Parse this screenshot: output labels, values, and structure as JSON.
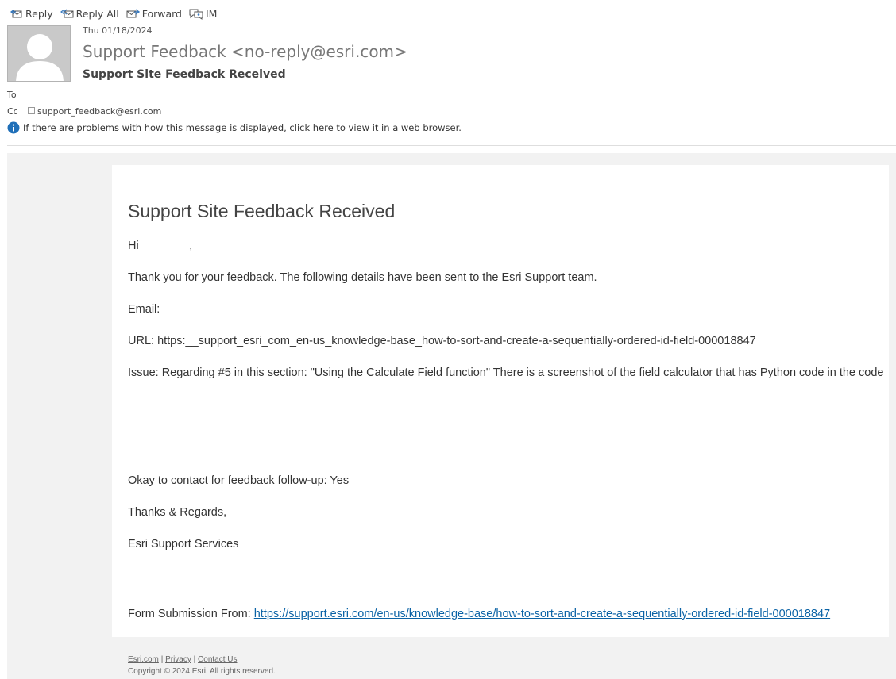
{
  "toolbar": {
    "reply": "Reply",
    "reply_all": "Reply All",
    "forward": "Forward",
    "im": "IM",
    "icons": [
      "reply-icon",
      "reply-all-icon",
      "forward-icon",
      "im-icon"
    ]
  },
  "header": {
    "date": "Thu 01/18/2024",
    "from": "Support Feedback <no-reply@esri.com>",
    "subject": "Support Site Feedback Received",
    "to_label": "To",
    "cc_label": "Cc",
    "cc_value": "support_feedback@esri.com",
    "info": "If there are problems with how this message is displayed, click here to view it in a web browser."
  },
  "message": {
    "title": "Support Site Feedback Received",
    "greeting": "Hi",
    "greeting_comma": ",",
    "intro": "Thank you for your feedback. The following details have been sent to the Esri Support team.",
    "email_line": "Email:",
    "url_line": "URL: https:__support_esri_com_en-us_knowledge-base_how-to-sort-and-create-a-sequentially-ordered-id-field-000018847",
    "issue_line": "Issue: Regarding #5 in this section: \"Using the Calculate Field function\" There is a screenshot of the field calculator that has Python code in the code",
    "followup": "Okay to contact for feedback follow-up: Yes",
    "thanks": "Thanks & Regards,",
    "signature": "Esri Support Services",
    "form_label": "Form Submission From: ",
    "form_link": "https://support.esri.com/en-us/knowledge-base/how-to-sort-and-create-a-sequentially-ordered-id-field-000018847"
  },
  "footer": {
    "link1": "Esri.com",
    "sep": "|",
    "link2": "Privacy",
    "link3": "Contact Us",
    "copyright": "Copyright © 2024 Esri. All rights reserved."
  },
  "colors": {
    "link": "#0b63a6",
    "background": "#f2f2f2",
    "card": "#ffffff",
    "info_icon": "#1f6fb8"
  }
}
